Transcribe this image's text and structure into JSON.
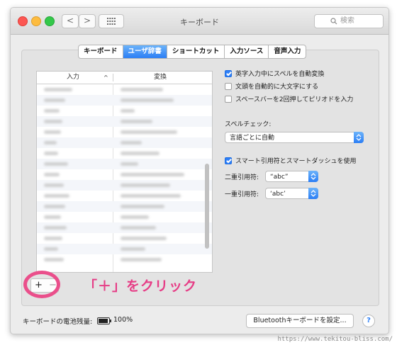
{
  "window": {
    "title": "キーボード",
    "search_placeholder": "検索"
  },
  "nav": {
    "back": "<",
    "forward": ">"
  },
  "tabs": [
    {
      "label": "キーボード",
      "active": false
    },
    {
      "label": "ユーザ辞書",
      "active": true
    },
    {
      "label": "ショートカット",
      "active": false
    },
    {
      "label": "入力ソース",
      "active": false
    },
    {
      "label": "音声入力",
      "active": false
    }
  ],
  "dictionary_table": {
    "col_input": "入力",
    "col_convert": "変換",
    "sort_indicator": "^"
  },
  "buttons": {
    "add": "+",
    "remove": "−",
    "bluetooth": "Bluetoothキーボードを設定...",
    "help": "?"
  },
  "options": {
    "auto_spell": {
      "label": "英字入力中にスペルを自動変換",
      "checked": true
    },
    "auto_capitalize": {
      "label": "文頭を自動的に大文字にする",
      "checked": false
    },
    "double_space_period": {
      "label": "スペースバーを2回押してピリオドを入力",
      "checked": false
    },
    "spell_check_label": "スペルチェック:",
    "spell_check_value": "言語ごとに自動",
    "smart_quotes": {
      "label": "スマート引用符とスマートダッシュを使用",
      "checked": true
    },
    "double_quote_label": "二重引用符:",
    "double_quote_value": "“abc”",
    "single_quote_label": "一重引用符:",
    "single_quote_value": "‘abc’"
  },
  "battery": {
    "label": "キーボードの電池残量:",
    "percent": "100%"
  },
  "annotation": {
    "callout": "「＋」をクリック"
  },
  "watermark": "https://www.tekitou-bliss.com/",
  "colors": {
    "accent": "#2b7ef5",
    "annotation": "#e63d86"
  }
}
